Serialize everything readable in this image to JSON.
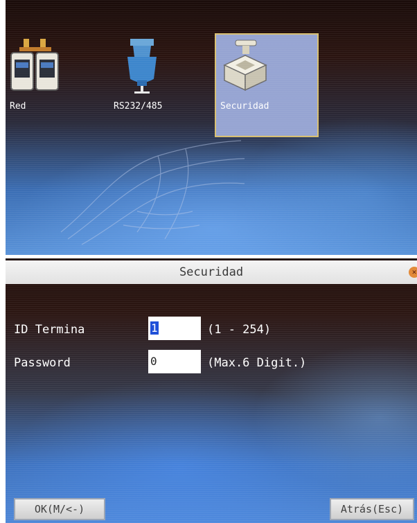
{
  "menu": {
    "items": [
      {
        "label": "Red",
        "icon": "network-icon",
        "selected": false
      },
      {
        "label": "RS232/485",
        "icon": "serial-port-icon",
        "selected": false
      },
      {
        "label": "Securidad",
        "icon": "security-device-icon",
        "selected": true
      }
    ]
  },
  "form": {
    "title": "Securidad",
    "fields": [
      {
        "label": "ID Termina",
        "value": "1",
        "hint": "(1 - 254)"
      },
      {
        "label": "Password",
        "value": "0",
        "hint": "(Max.6 Digit.)"
      }
    ],
    "ok_label": "OK(M/<-)",
    "back_label": "Atrás(Esc)"
  },
  "colors": {
    "selection_bg": "#96a4d2",
    "selection_border": "#d9c070",
    "cursor": "#2050d8",
    "title_bar": "#eaeaea"
  }
}
